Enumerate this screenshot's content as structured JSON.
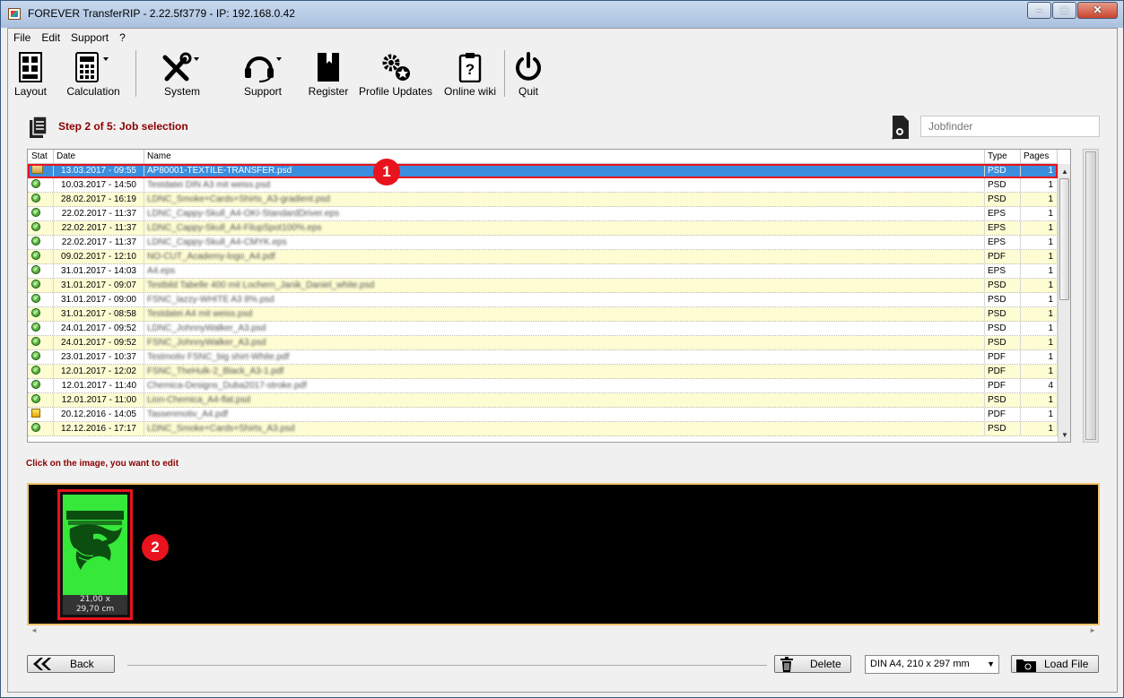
{
  "window": {
    "title": "FOREVER TransferRIP - 2.22.5f3779 - IP: 192.168.0.42"
  },
  "menu": [
    "File",
    "Edit",
    "Support",
    "?"
  ],
  "toolbar": {
    "layout": "Layout",
    "calculation": "Calculation",
    "system": "System",
    "support": "Support",
    "register": "Register",
    "profile_updates": "Profile Updates",
    "online_wiki": "Online wiki",
    "quit": "Quit"
  },
  "step": {
    "title": "Step 2 of 5: Job selection"
  },
  "jobfinder": {
    "placeholder": "Jobfinder"
  },
  "table": {
    "headers": [
      "Stat",
      "Date",
      "Name",
      "Type",
      "Pages"
    ],
    "rows": [
      {
        "status": "open",
        "date": "13.03.2017 - 09:55",
        "name": "AP80001-TEXTILE-TRANSFER.psd",
        "type": "PSD",
        "pages": "1",
        "selected": true
      },
      {
        "status": "ok",
        "date": "10.03.2017 - 14:50",
        "name": "Testdatei DIN A3 mit weiss.psd",
        "type": "PSD",
        "pages": "1"
      },
      {
        "status": "ok",
        "date": "28.02.2017 - 16:19",
        "name": "LDNC_Smoke+Cards+Shirts_A3-gradient.psd",
        "type": "PSD",
        "pages": "1"
      },
      {
        "status": "ok",
        "date": "22.02.2017 - 11:37",
        "name": "LDNC_Cappy-Skull_A4-OKI-StandardDriver.eps",
        "type": "EPS",
        "pages": "1"
      },
      {
        "status": "ok",
        "date": "22.02.2017 - 11:37",
        "name": "LDNC_Cappy-Skull_A4-FilupSpot100%.eps",
        "type": "EPS",
        "pages": "1"
      },
      {
        "status": "ok",
        "date": "22.02.2017 - 11:37",
        "name": "LDNC_Cappy-Skull_A4-CMYK.eps",
        "type": "EPS",
        "pages": "1"
      },
      {
        "status": "ok",
        "date": "09.02.2017 - 12:10",
        "name": "NO-CUT_Academy-logo_A4.pdf",
        "type": "PDF",
        "pages": "1"
      },
      {
        "status": "ok",
        "date": "31.01.2017 - 14:03",
        "name": "A4.eps",
        "type": "EPS",
        "pages": "1"
      },
      {
        "status": "ok",
        "date": "31.01.2017 - 09:07",
        "name": "Testbild Tabelle 400 mit Lochern_Janik_Daniel_white.psd",
        "type": "PSD",
        "pages": "1"
      },
      {
        "status": "ok",
        "date": "31.01.2017 - 09:00",
        "name": "FSNC_lazzy-WHITE A3 8%.psd",
        "type": "PSD",
        "pages": "1"
      },
      {
        "status": "ok",
        "date": "31.01.2017 - 08:58",
        "name": "Testdatei A4 mit weiss.psd",
        "type": "PSD",
        "pages": "1"
      },
      {
        "status": "ok",
        "date": "24.01.2017 - 09:52",
        "name": "LDNC_JohnnyWalker_A3.psd",
        "type": "PSD",
        "pages": "1"
      },
      {
        "status": "ok",
        "date": "24.01.2017 - 09:52",
        "name": "FSNC_JohnnyWalker_A3.psd",
        "type": "PSD",
        "pages": "1"
      },
      {
        "status": "ok",
        "date": "23.01.2017 - 10:37",
        "name": "Testmotiv FSNC_big shirt-White.pdf",
        "type": "PDF",
        "pages": "1"
      },
      {
        "status": "ok",
        "date": "12.01.2017 - 12:02",
        "name": "FSNC_TheHulk-2_Black_A3-1.pdf",
        "type": "PDF",
        "pages": "1"
      },
      {
        "status": "ok",
        "date": "12.01.2017 - 11:40",
        "name": "Chemica-Designs_Duba2017-stroke.pdf",
        "type": "PDF",
        "pages": "4"
      },
      {
        "status": "ok",
        "date": "12.01.2017 - 11:00",
        "name": "Lion-Chemica_A4-flat.psd",
        "type": "PSD",
        "pages": "1"
      },
      {
        "status": "warn",
        "date": "20.12.2016 - 14:05",
        "name": "Tassenmotiv_A4.pdf",
        "type": "PDF",
        "pages": "1"
      },
      {
        "status": "ok",
        "date": "12.12.2016 - 17:17",
        "name": "LDNC_Smoke+Cards+Shirts_A3.psd",
        "type": "PSD",
        "pages": "1"
      }
    ]
  },
  "callouts": {
    "one": "1",
    "two": "2"
  },
  "hint": "Click on the image, you want to edit",
  "preview": {
    "size_line1": "21,00 x",
    "size_line2": "29,70 cm"
  },
  "bottom": {
    "back": "Back",
    "delete": "Delete",
    "format": "DIN A4, 210 x 297 mm",
    "load_file": "Load File"
  }
}
